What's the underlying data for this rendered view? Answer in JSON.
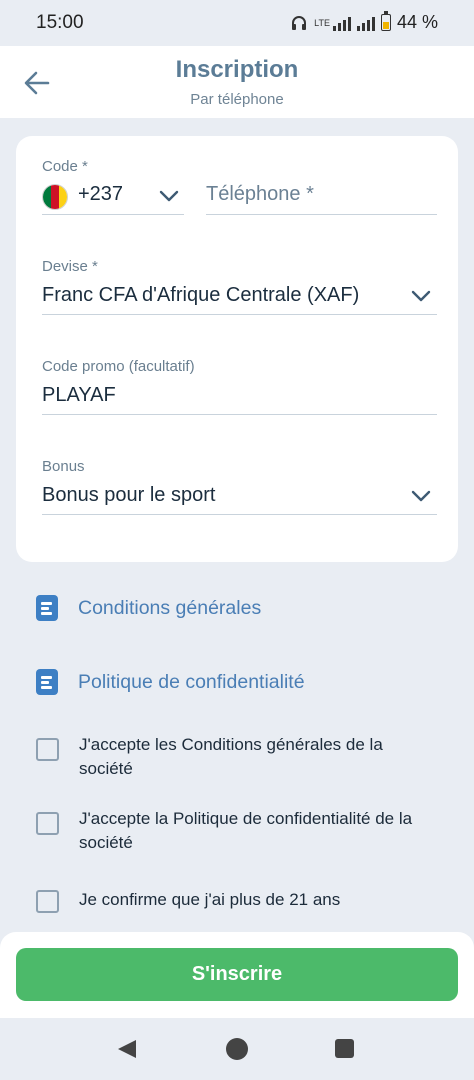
{
  "status": {
    "time": "15:00",
    "network": "LTE",
    "battery": "44 %"
  },
  "header": {
    "title": "Inscription",
    "subtitle": "Par téléphone"
  },
  "form": {
    "code": {
      "label": "Code *",
      "value": "+237"
    },
    "phone": {
      "placeholder": "Téléphone *"
    },
    "currency": {
      "label": "Devise *",
      "value": "Franc CFA d'Afrique Centrale (XAF)"
    },
    "promo": {
      "label": "Code promo (facultatif)",
      "value": "PLAYAF"
    },
    "bonus": {
      "label": "Bonus",
      "value": "Bonus pour le sport"
    }
  },
  "links": {
    "terms": "Conditions générales",
    "privacy": "Politique de confidentialité"
  },
  "checks": {
    "terms": "J'accepte les Conditions générales de la société",
    "privacy": "J'accepte la Politique de confidentialité de la société",
    "age": "Je confirme que j'ai plus de 21 ans"
  },
  "submit_label": "S'inscrire",
  "colors": {
    "accent": "#4cba6a",
    "link": "#4a7eb5",
    "title": "#5b7c96"
  }
}
